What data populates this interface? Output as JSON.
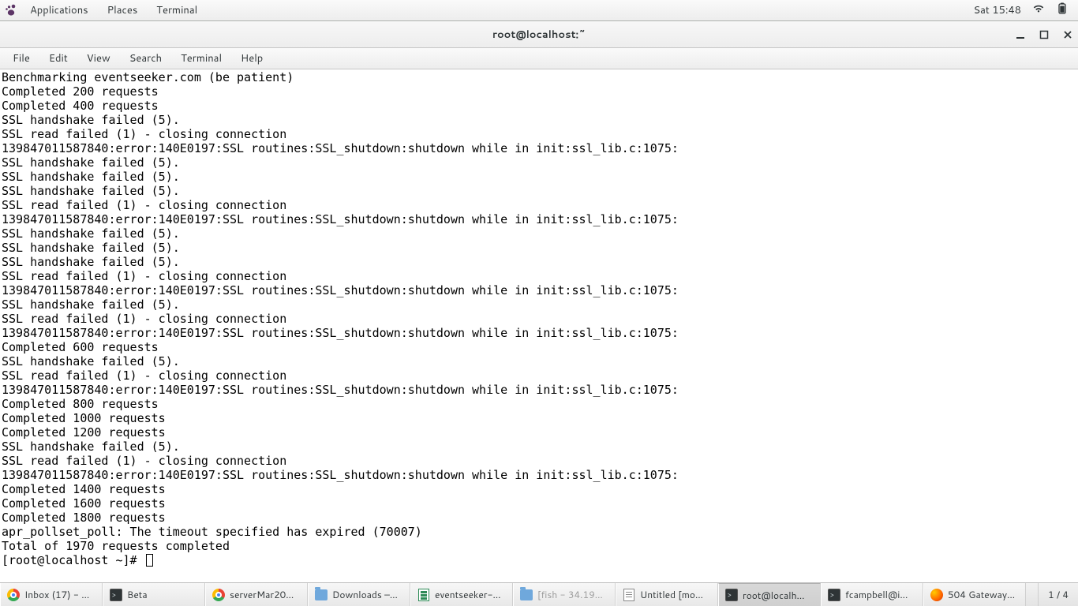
{
  "top_panel": {
    "applications": "Applications",
    "places": "Places",
    "terminal": "Terminal",
    "clock": "Sat 15:48"
  },
  "window": {
    "title": "root@localhost:~"
  },
  "menubar": {
    "file": "File",
    "edit": "Edit",
    "view": "View",
    "search": "Search",
    "terminal": "Terminal",
    "help": "Help"
  },
  "terminal_lines": [
    "Benchmarking eventseeker.com (be patient)",
    "Completed 200 requests",
    "Completed 400 requests",
    "SSL handshake failed (5).",
    "SSL read failed (1) - closing connection",
    "139847011587840:error:140E0197:SSL routines:SSL_shutdown:shutdown while in init:ssl_lib.c:1075:",
    "SSL handshake failed (5).",
    "SSL handshake failed (5).",
    "SSL handshake failed (5).",
    "SSL read failed (1) - closing connection",
    "139847011587840:error:140E0197:SSL routines:SSL_shutdown:shutdown while in init:ssl_lib.c:1075:",
    "SSL handshake failed (5).",
    "SSL handshake failed (5).",
    "SSL handshake failed (5).",
    "SSL read failed (1) - closing connection",
    "139847011587840:error:140E0197:SSL routines:SSL_shutdown:shutdown while in init:ssl_lib.c:1075:",
    "SSL handshake failed (5).",
    "SSL read failed (1) - closing connection",
    "139847011587840:error:140E0197:SSL routines:SSL_shutdown:shutdown while in init:ssl_lib.c:1075:",
    "Completed 600 requests",
    "SSL handshake failed (5).",
    "SSL read failed (1) - closing connection",
    "139847011587840:error:140E0197:SSL routines:SSL_shutdown:shutdown while in init:ssl_lib.c:1075:",
    "Completed 800 requests",
    "Completed 1000 requests",
    "Completed 1200 requests",
    "SSL handshake failed (5).",
    "SSL read failed (1) - closing connection",
    "139847011587840:error:140E0197:SSL routines:SSL_shutdown:shutdown while in init:ssl_lib.c:1075:",
    "Completed 1400 requests",
    "Completed 1600 requests",
    "Completed 1800 requests",
    "apr_pollset_poll: The timeout specified has expired (70007)",
    "Total of 1970 requests completed"
  ],
  "prompt": "[root@localhost ~]# ",
  "taskbar": {
    "items": [
      {
        "label": "Inbox (17) - …",
        "icon": "chrome",
        "active": false,
        "dim": false
      },
      {
        "label": "Beta",
        "icon": "term",
        "active": false,
        "dim": false
      },
      {
        "label": "serverMar20…",
        "icon": "chrome",
        "active": false,
        "dim": false
      },
      {
        "label": "Downloads –…",
        "icon": "folder",
        "active": false,
        "dim": false
      },
      {
        "label": "eventseeker-…",
        "icon": "green-doc",
        "active": false,
        "dim": false
      },
      {
        "label": "[fish - 34.19…",
        "icon": "folder",
        "active": false,
        "dim": true
      },
      {
        "label": "Untitled [mo…",
        "icon": "text-doc",
        "active": false,
        "dim": false
      },
      {
        "label": "root@localh…",
        "icon": "term",
        "active": true,
        "dim": false
      },
      {
        "label": "fcampbell@i…",
        "icon": "term",
        "active": false,
        "dim": false
      },
      {
        "label": "504 Gateway…",
        "icon": "firefox",
        "active": false,
        "dim": false
      }
    ],
    "workspace": "1 / 4"
  }
}
